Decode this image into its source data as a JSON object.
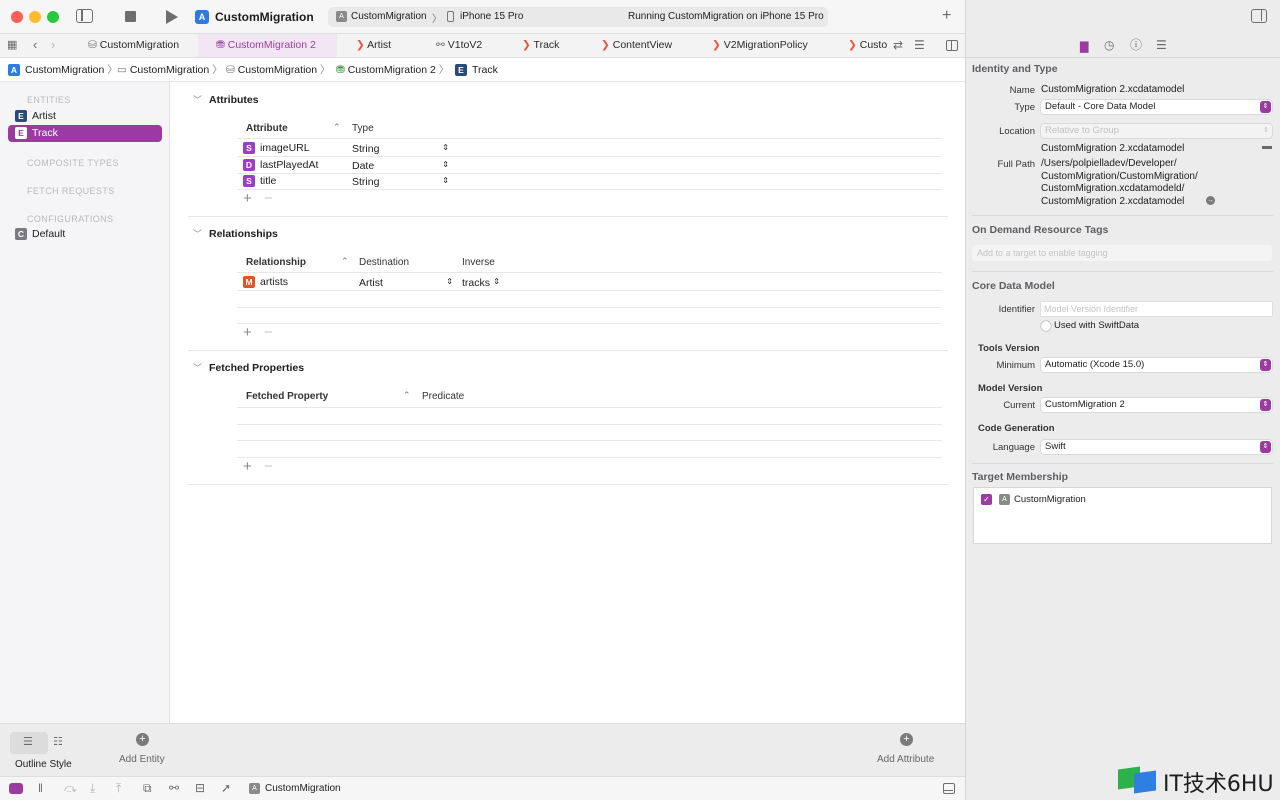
{
  "toolbar": {
    "project_title": "CustomMigration",
    "scheme_target": "CustomMigration",
    "scheme_device": "iPhone 15 Pro",
    "status": "Running CustomMigration on iPhone 15 Pro"
  },
  "tabs": [
    {
      "label": "CustomMigration",
      "icon": "database-icon"
    },
    {
      "label": "CustomMigration 2",
      "icon": "data-model-icon",
      "active": true
    },
    {
      "label": "Artist",
      "icon": "swift-icon"
    },
    {
      "label": "V1toV2",
      "icon": "mapping-icon"
    },
    {
      "label": "Track",
      "icon": "swift-icon"
    },
    {
      "label": "ContentView",
      "icon": "swift-icon"
    },
    {
      "label": "V2MigrationPolicy",
      "icon": "swift-icon"
    },
    {
      "label": "Custo",
      "icon": "swift-icon"
    }
  ],
  "breadcrumb": [
    "CustomMigration",
    "CustomMigration",
    "CustomMigration",
    "CustomMigration 2",
    "Track"
  ],
  "sidebar": {
    "entities_header": "ENTITIES",
    "entities": [
      {
        "badge": "E",
        "label": "Artist"
      },
      {
        "badge": "E",
        "label": "Track",
        "selected": true
      }
    ],
    "composite_header": "COMPOSITE TYPES",
    "fetch_header": "FETCH REQUESTS",
    "config_header": "CONFIGURATIONS",
    "configurations": [
      {
        "badge": "C",
        "label": "Default"
      }
    ]
  },
  "attributes": {
    "title": "Attributes",
    "col_attribute": "Attribute",
    "col_type": "Type",
    "rows": [
      {
        "badge": "S",
        "name": "imageURL",
        "type": "String"
      },
      {
        "badge": "D",
        "name": "lastPlayedAt",
        "type": "Date"
      },
      {
        "badge": "S",
        "name": "title",
        "type": "String"
      }
    ]
  },
  "relationships": {
    "title": "Relationships",
    "col_relationship": "Relationship",
    "col_destination": "Destination",
    "col_inverse": "Inverse",
    "rows": [
      {
        "badge": "M",
        "name": "artists",
        "destination": "Artist",
        "inverse": "tracks"
      }
    ]
  },
  "fetched": {
    "title": "Fetched Properties",
    "col_property": "Fetched Property",
    "col_predicate": "Predicate"
  },
  "bottom": {
    "outline_style": "Outline Style",
    "add_entity": "Add Entity",
    "add_attribute": "Add Attribute"
  },
  "statusbar": {
    "target": "CustomMigration"
  },
  "inspector": {
    "identity_header": "Identity and Type",
    "name_label": "Name",
    "name_value": "CustomMigration 2.xcdatamodel",
    "type_label": "Type",
    "type_value": "Default - Core Data Model",
    "location_label": "Location",
    "location_value": "Relative to Group",
    "file_name": "CustomMigration 2.xcdatamodel",
    "fullpath_label": "Full Path",
    "fullpath_lines": [
      "/Users/polpielladev/Developer/",
      "CustomMigration/CustomMigration/",
      "CustomMigration.xcdatamodeld/",
      "CustomMigration 2.xcdatamodel"
    ],
    "odr_header": "On Demand Resource Tags",
    "odr_placeholder": "Add to a target to enable tagging",
    "cdm_header": "Core Data Model",
    "identifier_label": "Identifier",
    "identifier_placeholder": "Model Version Identifier",
    "swiftdata_label": "Used with SwiftData",
    "tools_header": "Tools Version",
    "minimum_label": "Minimum",
    "minimum_value": "Automatic (Xcode 15.0)",
    "model_version_header": "Model Version",
    "current_label": "Current",
    "current_value": "CustomMigration 2",
    "codegen_header": "Code Generation",
    "language_label": "Language",
    "language_value": "Swift",
    "target_header": "Target Membership",
    "target_name": "CustomMigration"
  },
  "watermark": "IT技术6HU",
  "colors": {
    "accent": "#9b3aa0",
    "selection": "#9b3aa0",
    "swift": "#f05138"
  }
}
